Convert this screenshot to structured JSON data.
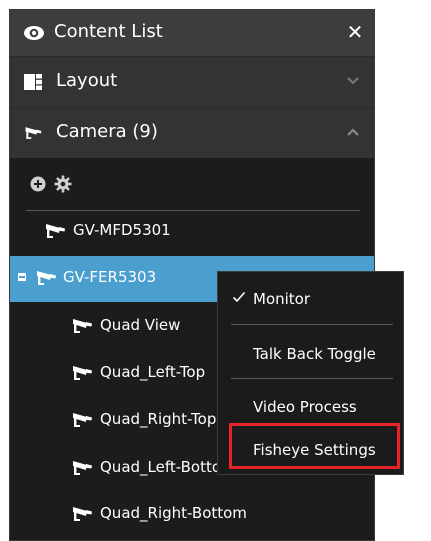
{
  "panel": {
    "title": "Content List",
    "close_label": "✕"
  },
  "sections": {
    "layout": {
      "label": "Layout",
      "state": "collapsed"
    },
    "camera": {
      "label": "Camera (9)",
      "state": "expanded"
    }
  },
  "tree": {
    "items": [
      {
        "label": "GV-MFD5301"
      },
      {
        "label": "GV-FER5303"
      },
      {
        "label": "Quad View"
      },
      {
        "label": "Quad_Left-Top"
      },
      {
        "label": "Quad_Right-Top"
      },
      {
        "label": "Quad_Left-Bottom"
      },
      {
        "label": "Quad_Right-Bottom"
      }
    ]
  },
  "context_menu": {
    "items": [
      {
        "label": "Monitor",
        "checked": true
      },
      {
        "label": "Talk Back Toggle"
      },
      {
        "label": "Video Process"
      },
      {
        "label": "Fisheye Settings",
        "highlighted": true
      }
    ]
  },
  "colors": {
    "panel_bg": "#1c1c1c",
    "titlebar_bg": "#3d3d3d",
    "section_bg": "#333333",
    "selected_bg": "#4a9fcf",
    "highlight_border": "#e8242b"
  },
  "icons": {
    "title": "eye-icon",
    "layout": "grid-layout-icon",
    "camera": "camera-icon",
    "tools": [
      "add-circle-icon",
      "gear-icon"
    ]
  }
}
